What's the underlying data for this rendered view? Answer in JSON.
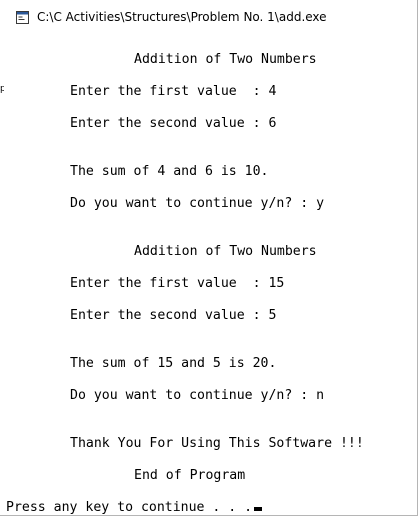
{
  "window": {
    "title": "C:\\C Activities\\Structures\\Problem No. 1\\add.exe",
    "icon": "console-app-icon"
  },
  "console": {
    "lines": [
      "Addition of Two Numbers",
      "Enter the first value  : 4",
      "Enter the second value : 6",
      "The sum of 4 and 6 is 10.",
      "Do you want to continue y/n? : y",
      "Addition of Two Numbers",
      "Enter the first value  : 15",
      "Enter the second value : 5",
      "The sum of 15 and 5 is 20.",
      "Do you want to continue y/n? : n",
      "Thank You For Using This Software !!!",
      "End of Program",
      "Press any key to continue . . ."
    ]
  },
  "colors": {
    "background": "#ffffff",
    "text": "#000000"
  }
}
